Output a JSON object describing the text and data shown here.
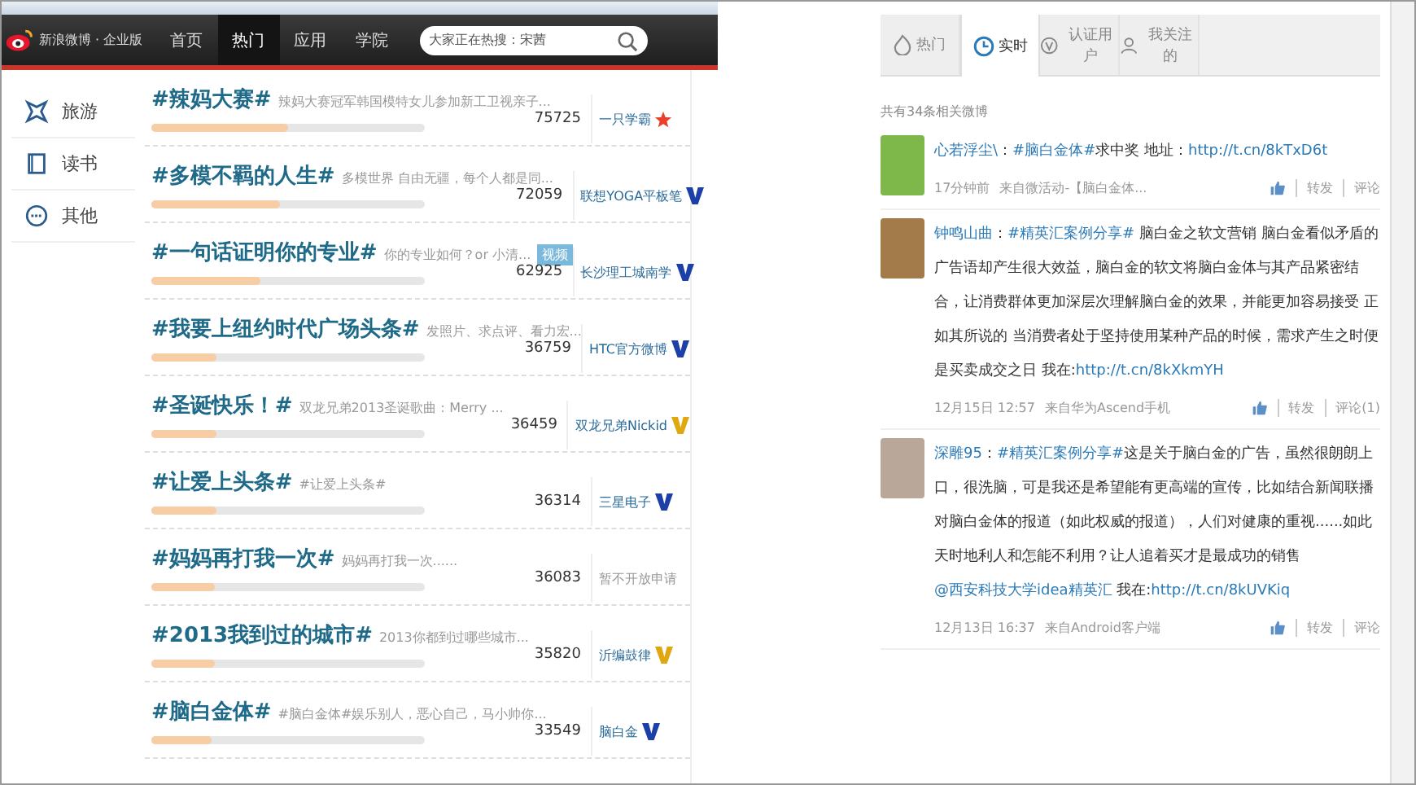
{
  "header": {
    "logo": "新浪微博 · 企业版",
    "nav": [
      {
        "label": "首页",
        "selected": false
      },
      {
        "label": "热门",
        "selected": true
      },
      {
        "label": "应用",
        "selected": false
      },
      {
        "label": "学院",
        "selected": false
      }
    ],
    "search": {
      "placeholder": "大家正在热搜：宋茜"
    }
  },
  "sidebar": {
    "items": [
      {
        "label": "旅游",
        "kind": "travel"
      },
      {
        "label": "读书",
        "kind": "book"
      },
      {
        "label": "其他",
        "kind": "other"
      }
    ]
  },
  "topics": [
    {
      "title": "#辣妈大赛#",
      "desc": "辣妈大赛冠军韩国模特女儿参加新工卫视亲子...",
      "count": "75725",
      "level": 0.5,
      "author": "一只学霸",
      "kind": "star"
    },
    {
      "title": "#多模不羁的人生#",
      "desc": "多模世界 自由无疆，每个人都是同...",
      "count": "72059",
      "level": 0.47,
      "author": "联想YOGA平板笔",
      "kind": "blue_v"
    },
    {
      "title": "#一句话证明你的专业#",
      "desc": "你的专业如何？or 小清...",
      "tag": "视频",
      "count": "62925",
      "level": 0.4,
      "author": "长沙理工城南学",
      "kind": "blue_v"
    },
    {
      "title": "#我要上纽约时代广场头条#",
      "desc": "发照片、求点评、看力宏...",
      "count": "36759",
      "level": 0.24,
      "author": "HTC官方微博",
      "kind": "blue_v"
    },
    {
      "title": "#圣诞快乐！#",
      "desc": "双龙兄弟2013圣诞歌曲：Merry ...",
      "count": "36459",
      "level": 0.24,
      "author": "双龙兄弟Nickid",
      "kind": "gold_v"
    },
    {
      "title": "#让爱上头条#",
      "desc": "#让爱上头条#",
      "count": "36314",
      "level": 0.24,
      "author": "三星电子",
      "kind": "blue_v"
    },
    {
      "title": "#妈妈再打我一次#",
      "desc": "妈妈再打我一次......",
      "count": "36083",
      "level": 0.23,
      "author": "暂不开放申请",
      "kind": "notice"
    },
    {
      "title": "#2013我到过的城市#",
      "desc": "2013你都到过哪些城市...",
      "count": "35820",
      "level": 0.23,
      "author": "沂编鼓律",
      "kind": "gold_v"
    },
    {
      "title": "#脑白金体#",
      "desc": "#脑白金体#娱乐别人，恶心自己，马小帅你...",
      "count": "33549",
      "level": 0.22,
      "author": "脑白金",
      "kind": "blue_v"
    }
  ],
  "feed": {
    "tabs": [
      {
        "label": "热门",
        "kind": "hot",
        "selected": false
      },
      {
        "label": "实时",
        "kind": "clock",
        "selected": true
      },
      {
        "label": "认证用户",
        "kind": "verified",
        "selected": false
      },
      {
        "label": "我关注的",
        "kind": "person",
        "selected": false
      }
    ],
    "result_count": "共有34条相关微博",
    "posts": [
      {
        "segments": [
          {
            "kind": "user",
            "text": "心若浮尘\\"
          },
          {
            "kind": "text",
            "text": "："
          },
          {
            "kind": "topic",
            "text": "#脑白金体#"
          },
          {
            "kind": "text",
            "text": "求中奖 地址："
          },
          {
            "kind": "link",
            "text": "http://t.cn/8kTxD6t"
          }
        ],
        "time": "17分钟前",
        "source": "来自微活动-【脑白金体...",
        "actions": [
          "转发",
          "评论"
        ]
      },
      {
        "segments": [
          {
            "kind": "user",
            "text": "钟鸣山曲"
          },
          {
            "kind": "text",
            "text": "："
          },
          {
            "kind": "topic",
            "text": "#精英汇案例分享#"
          },
          {
            "kind": "text",
            "text": " 脑白金之软文营销 脑白金看似矛盾的广告语却产生很大效益，脑白金的软文将脑白金体与其产品紧密结合，让消费群体更加深层次理解脑白金的效果，并能更加容易接受 正如其所说的 当消费者处于坚持使用某种产品的时候，需求产生之时便是买卖成交之日 我在:"
          },
          {
            "kind": "link",
            "text": "http://t.cn/8kXkmYH"
          }
        ],
        "time": "12月15日 12:57",
        "source": "来自华为Ascend手机",
        "actions": [
          "转发",
          "评论(1)"
        ]
      },
      {
        "segments": [
          {
            "kind": "user",
            "text": "深雕95"
          },
          {
            "kind": "text",
            "text": "："
          },
          {
            "kind": "topic",
            "text": "#精英汇案例分享#"
          },
          {
            "kind": "text",
            "text": "这是关于脑白金的广告，虽然很朗朗上口，很洗脑，可是我还是希望能有更高端的宣传，比如结合新闻联播对脑白金体的报道（如此权威的报道），人们对健康的重视......如此天时地利人和怎能不利用？让人追着买才是最成功的销售"
          },
          {
            "kind": "link",
            "text": "@西安科技大学idea精英汇"
          },
          {
            "kind": "text",
            "text": " 我在:"
          },
          {
            "kind": "link",
            "text": "http://t.cn/8kUVKiq"
          }
        ],
        "time": "12月13日 16:37",
        "source": "来自Android客户端",
        "actions": [
          "转发",
          "评论"
        ]
      }
    ]
  }
}
